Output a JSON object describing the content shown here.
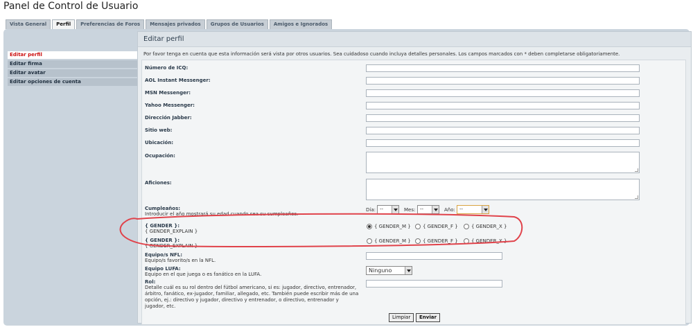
{
  "page_title": "Panel de Control de Usuario",
  "tabs": [
    "Vista General",
    "Perfil",
    "Preferencias de Foros",
    "Mensajes privados",
    "Grupos de Usuarios",
    "Amigos e Ignorados"
  ],
  "active_tab": "Perfil",
  "sidebar": {
    "items": [
      "Editar perfil",
      "Editar firma",
      "Editar avatar",
      "Editar opciones de cuenta"
    ],
    "active": "Editar perfil"
  },
  "content": {
    "heading": "Editar perfil",
    "notice": "Por favor tenga en cuenta que esta información será vista por otros usuarios. Sea cuidadoso cuando incluya detalles personales. Los campos marcados con * deben completarse obligatoriamente."
  },
  "fields": {
    "icq": "Número de ICQ:",
    "aim": "AOL Instant Messenger:",
    "msn": "MSN Messenger:",
    "yahoo": "Yahoo Messenger:",
    "jabber": "Dirección Jabber:",
    "website": "Sitio web:",
    "location": "Ubicación:",
    "occupation": "Ocupación:",
    "interests": "Aficiones:"
  },
  "birthday": {
    "label": "Cumpleaños:",
    "explain": "Introducir el año mostrará su edad cuando sea su cumpleaños.",
    "day_label": "Día:",
    "month_label": "Mes:",
    "year_label": "Año:",
    "day_value": "--",
    "month_value": "--",
    "year_value": "--"
  },
  "gender1": {
    "label": "{ GENDER }:",
    "explain": "{ GENDER_EXPLAIN }",
    "options": [
      "{ GENDER_M }",
      "{ GENDER_F }",
      "{ GENDER_X }"
    ],
    "selected": 0
  },
  "gender2": {
    "label": "{ GENDER }:",
    "explain": "{ GENDER_EXPLAIN }",
    "options": [
      "{ GENDER_M }",
      "{ GENDER_F }",
      "{ GENDER_X }"
    ],
    "selected": -1
  },
  "nfl": {
    "label": "Equipo/s NFL:",
    "explain": "Equipo/s favorito/s en la NFL."
  },
  "lufa": {
    "label": "Equipo LUFA:",
    "explain": "Equipo en el que juega o es fanático en la LUFA.",
    "value": "Ninguno"
  },
  "rol": {
    "label": "Rol:",
    "explain_lines": [
      "Detalle cuál es su rol dentro del fútbol americano, si es: jugador, directivo, entrenador,",
      "árbitro, fanático, ex-jugador, familiar, allegado, etc. También puede escribir más de una",
      "opción, ej.: directivo y jugador, directivo y entrenador, o directivo, entrenador y",
      "jugador, etc."
    ]
  },
  "buttons": {
    "reset": "Limpiar",
    "submit": "Enviar"
  },
  "colors": {
    "panel_bg": "#cad4dd",
    "active_sidebar_text": "#cc1111",
    "annotation": "#e0424a"
  }
}
